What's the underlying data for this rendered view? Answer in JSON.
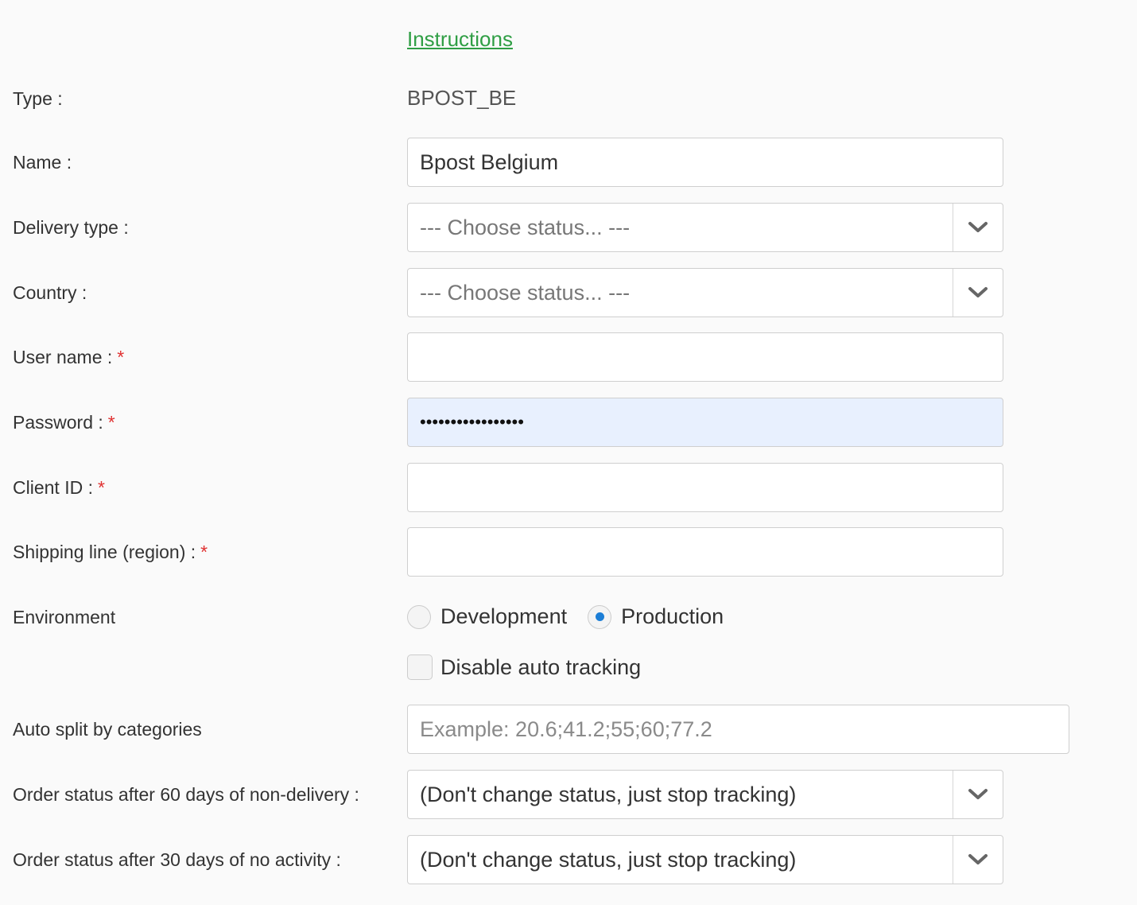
{
  "instructions_link": "Instructions",
  "fields": {
    "type": {
      "label": "Type :",
      "value": "BPOST_BE"
    },
    "name": {
      "label": "Name :",
      "value": "Bpost Belgium"
    },
    "delivery_type": {
      "label": "Delivery type :",
      "selected": "--- Choose status... ---"
    },
    "country": {
      "label": "Country :",
      "selected": "--- Choose status... ---"
    },
    "user_name": {
      "label": "User name :",
      "required_mark": "*",
      "value": ""
    },
    "password": {
      "label": "Password :",
      "required_mark": "*",
      "value": "•••••••••••••••••"
    },
    "client_id": {
      "label": "Client ID :",
      "required_mark": "*",
      "value": ""
    },
    "shipping_line": {
      "label": "Shipping line (region) :",
      "required_mark": "*",
      "value": ""
    },
    "environment": {
      "label": "Environment",
      "options": [
        "Development",
        "Production"
      ],
      "selected": "Production"
    },
    "disable_tracking": {
      "label": "Disable auto tracking",
      "checked": false
    },
    "auto_split": {
      "label": "Auto split by categories",
      "placeholder": "Example: 20.6;41.2;55;60;77.2"
    },
    "status_60_days": {
      "label": "Order status after 60 days of non-delivery :",
      "selected": "(Don't change status, just stop tracking)"
    },
    "status_30_days": {
      "label": "Order status after 30 days of no activity :",
      "selected": "(Don't change status, just stop tracking)"
    }
  },
  "icons": {
    "select_arrow": "chevron-down-icon"
  },
  "colors": {
    "link": "#2f9e44",
    "required": "#e03131",
    "radio_selected": "#1c7ed6",
    "autofill_bg": "#e8f0fe"
  }
}
